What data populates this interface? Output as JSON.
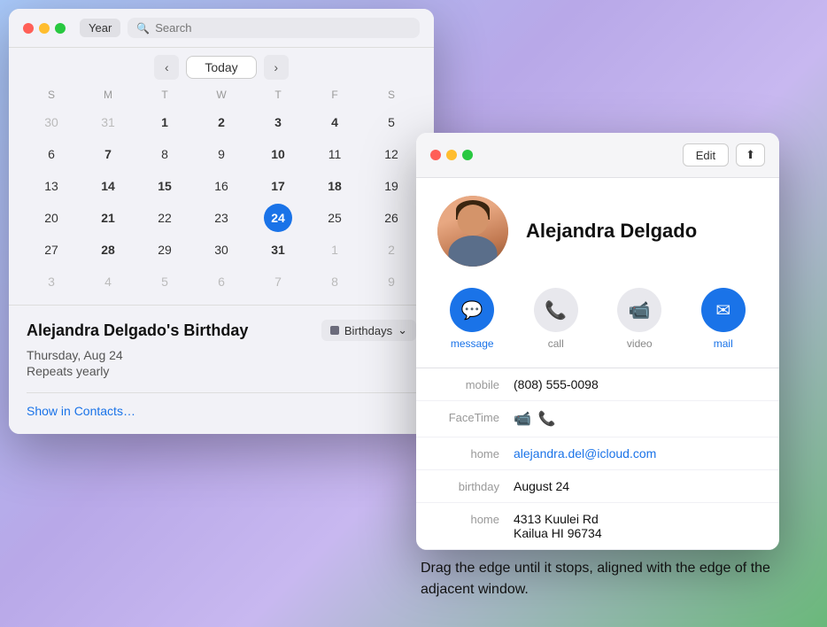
{
  "calendar": {
    "title": "Year",
    "search_placeholder": "Search",
    "nav": {
      "prev": "‹",
      "today": "Today",
      "next": "›"
    },
    "day_headers": [
      "S",
      "M",
      "T",
      "W",
      "T",
      "F",
      "S"
    ],
    "weeks": [
      [
        {
          "day": "30",
          "other": true
        },
        {
          "day": "31",
          "other": true
        },
        {
          "day": "1",
          "bold": true
        },
        {
          "day": "2",
          "bold": true
        },
        {
          "day": "3",
          "bold": true
        },
        {
          "day": "4",
          "bold": true
        },
        {
          "day": "5"
        }
      ],
      [
        {
          "day": "6"
        },
        {
          "day": "7",
          "bold": true
        },
        {
          "day": "8"
        },
        {
          "day": "9"
        },
        {
          "day": "10",
          "bold": true
        },
        {
          "day": "11"
        },
        {
          "day": "12"
        }
      ],
      [
        {
          "day": "13"
        },
        {
          "day": "14",
          "bold": true
        },
        {
          "day": "15",
          "bold": true
        },
        {
          "day": "16"
        },
        {
          "day": "17",
          "bold": true
        },
        {
          "day": "18",
          "bold": true
        },
        {
          "day": "19"
        }
      ],
      [
        {
          "day": "20"
        },
        {
          "day": "21",
          "bold": true
        },
        {
          "day": "22"
        },
        {
          "day": "23"
        },
        {
          "day": "24",
          "today": true
        },
        {
          "day": "25"
        },
        {
          "day": "26"
        }
      ],
      [
        {
          "day": "27"
        },
        {
          "day": "28",
          "bold": true
        },
        {
          "day": "29"
        },
        {
          "day": "30"
        },
        {
          "day": "31",
          "bold": true
        },
        {
          "day": "1",
          "other": true
        },
        {
          "day": "2",
          "other": true
        }
      ],
      [
        {
          "day": "3",
          "other": true
        },
        {
          "day": "4",
          "other": true
        },
        {
          "day": "5",
          "other": true
        },
        {
          "day": "6",
          "other": true
        },
        {
          "day": "7",
          "other": true
        },
        {
          "day": "8",
          "other": true
        },
        {
          "day": "9",
          "other": true
        }
      ]
    ],
    "event": {
      "title": "Alejandra Delgado's Birthday",
      "badge": "Birthdays",
      "date": "Thursday, Aug 24",
      "repeat": "Repeats yearly",
      "link": "Show in Contacts…"
    }
  },
  "contact": {
    "name": "Alejandra Delgado",
    "edit_label": "Edit",
    "share_label": "⬆",
    "actions": [
      {
        "label": "message",
        "active": true,
        "icon": "💬"
      },
      {
        "label": "call",
        "active": false,
        "icon": "📞"
      },
      {
        "label": "video",
        "active": false,
        "icon": "📹"
      },
      {
        "label": "mail",
        "active": true,
        "icon": "✉"
      }
    ],
    "fields": [
      {
        "label": "mobile",
        "value": "(808) 555-0098",
        "type": "text"
      },
      {
        "label": "FaceTime",
        "value": "",
        "type": "facetime"
      },
      {
        "label": "home",
        "value": "alejandra.del@icloud.com",
        "type": "link"
      },
      {
        "label": "birthday",
        "value": "August 24",
        "type": "text"
      },
      {
        "label": "home",
        "value": "4313 Kuulei Rd\nKailua HI 96734",
        "type": "text"
      }
    ]
  },
  "instruction": {
    "text": "Drag the edge until it stops, aligned with the edge of the adjacent window."
  }
}
